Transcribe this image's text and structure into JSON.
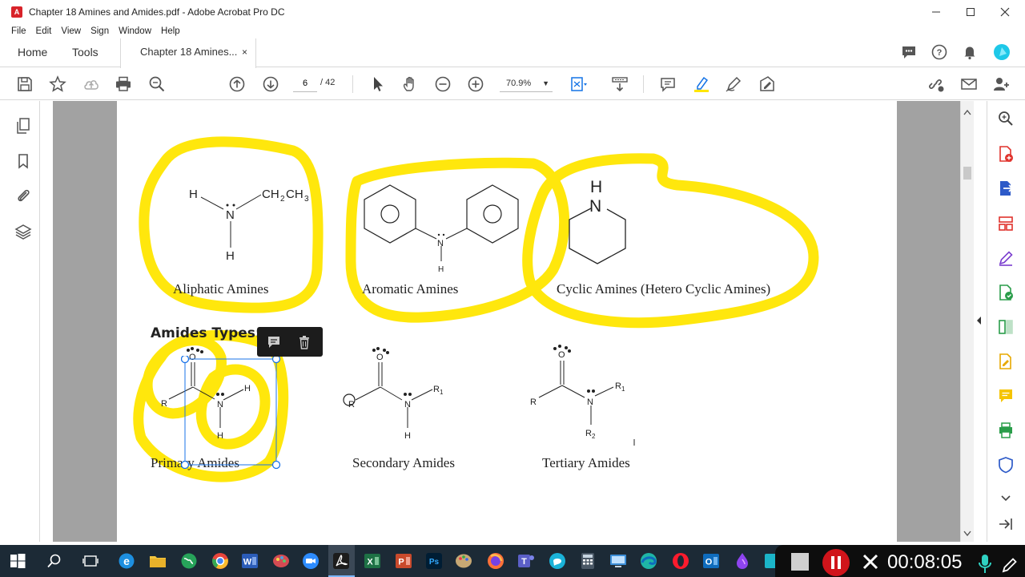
{
  "window": {
    "title": "Chapter 18 Amines and Amides.pdf - Adobe Acrobat Pro DC"
  },
  "menu": [
    "File",
    "Edit",
    "View",
    "Sign",
    "Window",
    "Help"
  ],
  "tabs": {
    "home": "Home",
    "tools": "Tools",
    "document": "Chapter 18 Amines...",
    "close": "×"
  },
  "toolbar": {
    "page_current": "6",
    "page_total": "/ 42",
    "zoom": "70.9%"
  },
  "document": {
    "amines": [
      {
        "label": "Aliphatic Amines"
      },
      {
        "label": "Aromatic Amines"
      },
      {
        "label": "Cyclic Amines (Hetero Cyclic Amines)"
      }
    ],
    "amides_heading": "Amides Types:",
    "amides": [
      {
        "label": "Primary Amides"
      },
      {
        "label": "Secondary Amides"
      },
      {
        "label": "Tertiary Amides"
      }
    ],
    "atoms": {
      "H": "H",
      "N": "N",
      "O": "O",
      "R": "R",
      "ch2": "CH",
      "sub2": "2",
      "ch3": "CH",
      "sub3": "3",
      "R1": "R",
      "sub1": "1",
      "R2": "R"
    },
    "highlight_color": "#ffe600"
  },
  "taskbar": {
    "recording_time": "00:08:05"
  }
}
